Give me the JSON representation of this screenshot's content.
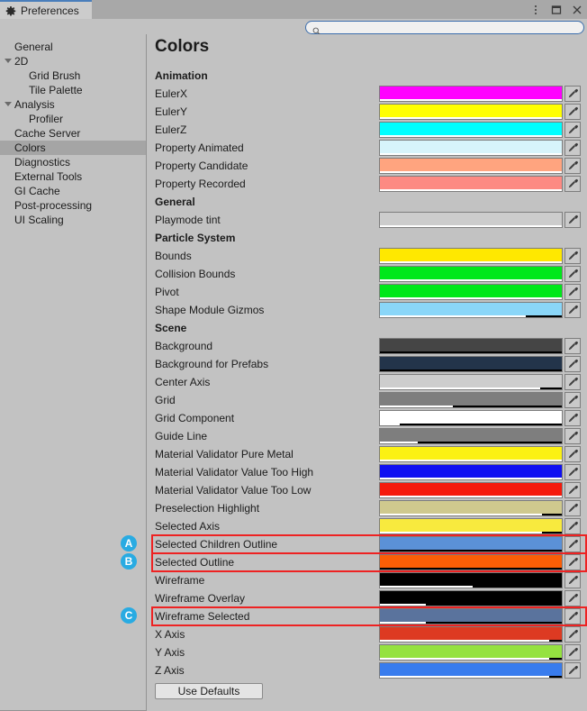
{
  "window": {
    "tab_label": "Preferences",
    "tab_icon": "gear-icon",
    "menu_icon": "kebab-menu-icon",
    "maximize_icon": "maximize-icon",
    "close_icon": "close-icon"
  },
  "search": {
    "icon": "search-icon",
    "value": "",
    "placeholder": ""
  },
  "sidebar": {
    "items": [
      {
        "label": "General",
        "indent": 1,
        "expandable": false,
        "selected": false
      },
      {
        "label": "2D",
        "indent": 1,
        "expandable": true,
        "selected": false
      },
      {
        "label": "Grid Brush",
        "indent": 2,
        "expandable": false,
        "selected": false
      },
      {
        "label": "Tile Palette",
        "indent": 2,
        "expandable": false,
        "selected": false
      },
      {
        "label": "Analysis",
        "indent": 1,
        "expandable": true,
        "selected": false
      },
      {
        "label": "Profiler",
        "indent": 2,
        "expandable": false,
        "selected": false
      },
      {
        "label": "Cache Server",
        "indent": 1,
        "expandable": false,
        "selected": false
      },
      {
        "label": "Colors",
        "indent": 1,
        "expandable": false,
        "selected": true
      },
      {
        "label": "Diagnostics",
        "indent": 1,
        "expandable": false,
        "selected": false
      },
      {
        "label": "External Tools",
        "indent": 1,
        "expandable": false,
        "selected": false
      },
      {
        "label": "GI Cache",
        "indent": 1,
        "expandable": false,
        "selected": false
      },
      {
        "label": "Post-processing",
        "indent": 1,
        "expandable": false,
        "selected": false
      },
      {
        "label": "UI Scaling",
        "indent": 1,
        "expandable": false,
        "selected": false
      }
    ]
  },
  "page": {
    "title": "Colors",
    "use_defaults_label": "Use Defaults",
    "dropper_icon": "eyedropper-icon"
  },
  "rows": [
    {
      "kind": "group",
      "label": "Animation"
    },
    {
      "kind": "color",
      "label": "EulerX",
      "color": "#ff00ff",
      "alpha": 100
    },
    {
      "kind": "color",
      "label": "EulerY",
      "color": "#ffff00",
      "alpha": 100
    },
    {
      "kind": "color",
      "label": "EulerZ",
      "color": "#00ffff",
      "alpha": 100
    },
    {
      "kind": "color",
      "label": "Property Animated",
      "color": "#d7f4fb",
      "alpha": 100
    },
    {
      "kind": "color",
      "label": "Property Candidate",
      "color": "#ffa47f",
      "alpha": 100
    },
    {
      "kind": "color",
      "label": "Property Recorded",
      "color": "#fd8a83",
      "alpha": 100
    },
    {
      "kind": "group",
      "label": "General"
    },
    {
      "kind": "color",
      "label": "Playmode tint",
      "color": "#cccccc",
      "alpha": 100
    },
    {
      "kind": "group",
      "label": "Particle System"
    },
    {
      "kind": "color",
      "label": "Bounds",
      "color": "#ffe800",
      "alpha": 100
    },
    {
      "kind": "color",
      "label": "Collision Bounds",
      "color": "#00e81a",
      "alpha": 100
    },
    {
      "kind": "color",
      "label": "Pivot",
      "color": "#00e81a",
      "alpha": 100
    },
    {
      "kind": "color",
      "label": "Shape Module Gizmos",
      "color": "#8ad6f8",
      "alpha": 80
    },
    {
      "kind": "group",
      "label": "Scene"
    },
    {
      "kind": "color",
      "label": "Background",
      "color": "#454545",
      "alpha": 0
    },
    {
      "kind": "color",
      "label": "Background for Prefabs",
      "color": "#23344a",
      "alpha": 0
    },
    {
      "kind": "color",
      "label": "Center Axis",
      "color": "#cdcdcd",
      "alpha": 88
    },
    {
      "kind": "color",
      "label": "Grid",
      "color": "#7e7e7e",
      "alpha": 40
    },
    {
      "kind": "color",
      "label": "Grid Component",
      "color": "#ffffff",
      "alpha": 11
    },
    {
      "kind": "color",
      "label": "Guide Line",
      "color": "#7e7e7e",
      "alpha": 21
    },
    {
      "kind": "color",
      "label": "Material Validator Pure Metal",
      "color": "#fbf113",
      "alpha": 100
    },
    {
      "kind": "color",
      "label": "Material Validator Value Too High",
      "color": "#0f0ff2",
      "alpha": 100
    },
    {
      "kind": "color",
      "label": "Material Validator Value Too Low",
      "color": "#f51a0c",
      "alpha": 100
    },
    {
      "kind": "color",
      "label": "Preselection Highlight",
      "color": "#cfc98e",
      "alpha": 89
    },
    {
      "kind": "color",
      "label": "Selected Axis",
      "color": "#f8ea3e",
      "alpha": 89
    },
    {
      "kind": "color",
      "label": "Selected Children Outline",
      "color": "#5b91d7",
      "alpha": 0,
      "marker": "A",
      "highlighted": true
    },
    {
      "kind": "color",
      "label": "Selected Outline",
      "color": "#fb5e06",
      "alpha": 0,
      "marker": "B",
      "highlighted": true
    },
    {
      "kind": "color",
      "label": "Wireframe",
      "color": "#000000",
      "alpha": 51
    },
    {
      "kind": "color",
      "label": "Wireframe Overlay",
      "color": "#000000",
      "alpha": 25
    },
    {
      "kind": "color",
      "label": "Wireframe Selected",
      "color": "#5a739d",
      "alpha": 25,
      "marker": "C",
      "highlighted": true
    },
    {
      "kind": "color",
      "label": "X Axis",
      "color": "#dd3a22",
      "alpha": 93
    },
    {
      "kind": "color",
      "label": "Y Axis",
      "color": "#95e240",
      "alpha": 93
    },
    {
      "kind": "color",
      "label": "Z Axis",
      "color": "#397ced",
      "alpha": 93
    }
  ],
  "colors": {
    "window_bg": "#c2c2c2",
    "titlebar_bg": "#a8a8a8",
    "tab_bg": "#cccccc",
    "tab_accent": "#4a7ebb",
    "sidebar_selected": "#a5a5a5",
    "highlight_border": "#ee2222",
    "badge_bg": "#29abe2",
    "search_border": "#3c6ead"
  }
}
